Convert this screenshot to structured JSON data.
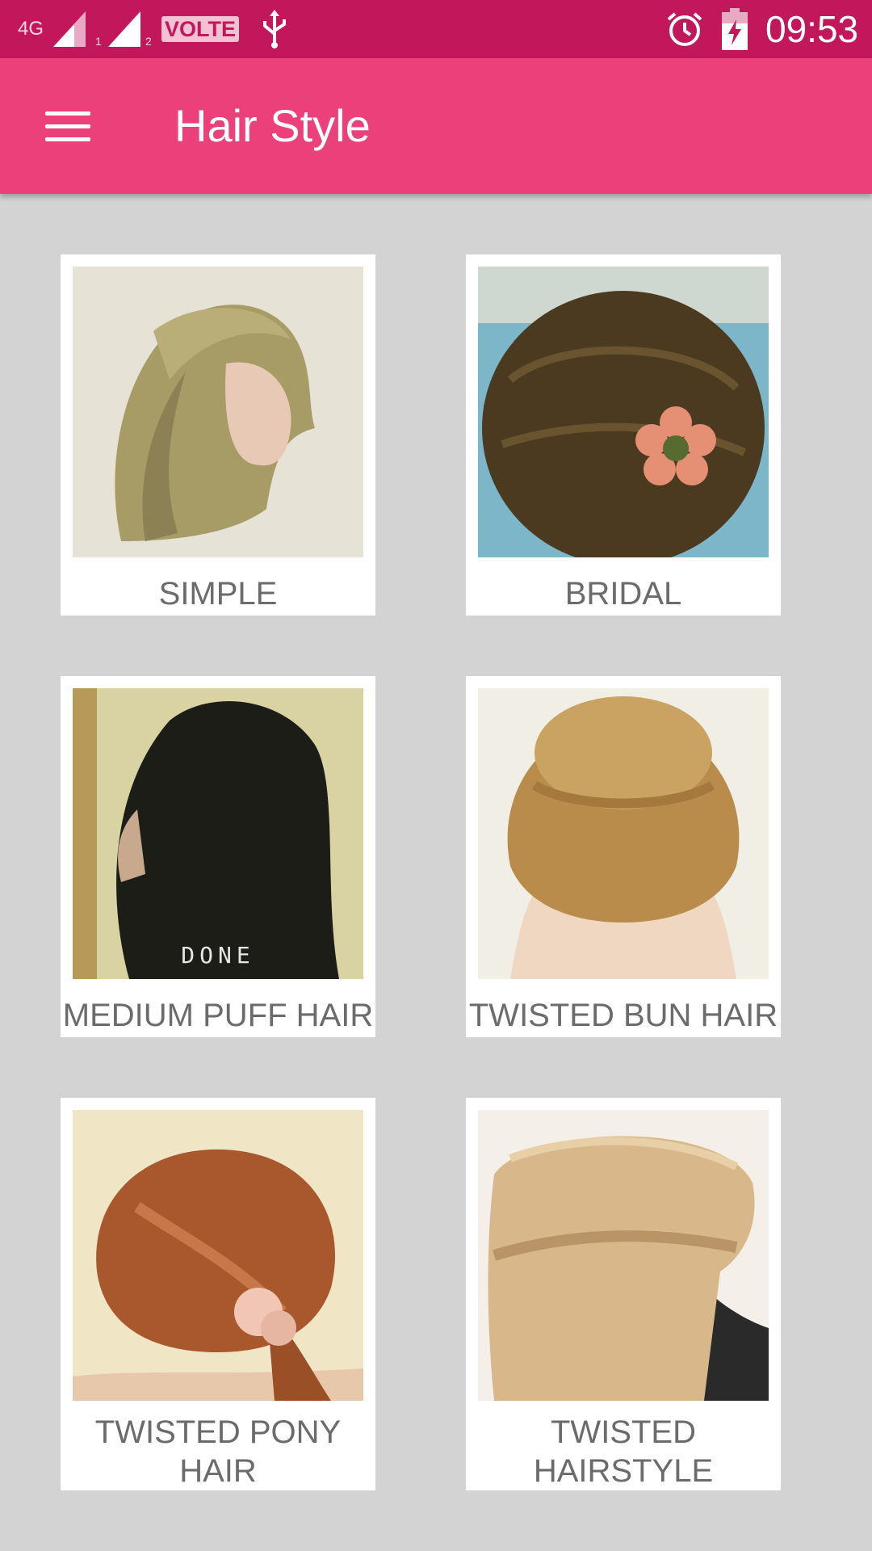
{
  "status_bar": {
    "network": "4G",
    "sim1": "1",
    "sim2": "2",
    "volte": "VOLTE",
    "time": "09:53"
  },
  "app_bar": {
    "title": "Hair Style",
    "menu_icon": "hamburger-menu-icon"
  },
  "categories": [
    {
      "label": "SIMPLE"
    },
    {
      "label": "BRIDAL"
    },
    {
      "label": "MEDIUM PUFF HAIR"
    },
    {
      "label": "TWISTED BUN HAIR"
    },
    {
      "label": "TWISTED PONY HAIR"
    },
    {
      "label": "TWISTED HAIRSTYLE"
    }
  ],
  "image_overlays": {
    "medium_puff_caption": "DONE"
  },
  "colors": {
    "status_bar": "#c2185b",
    "app_bar": "#ec407a",
    "background": "#d3d3d3"
  }
}
